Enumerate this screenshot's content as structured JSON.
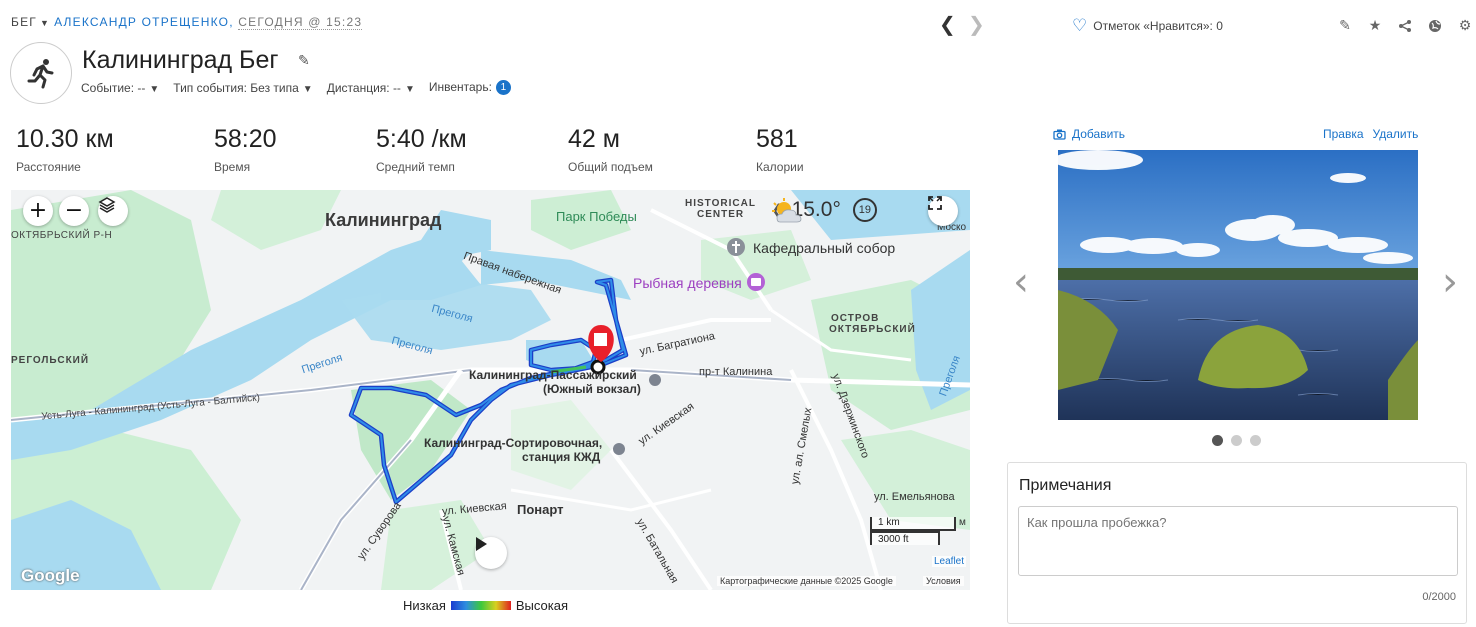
{
  "header": {
    "activity_type": "БЕГ",
    "author": "АЛЕКСАНДР ОТРЕЩЕНКО,",
    "date": "СЕГОДНЯ @ 15:23",
    "likes": "Отметок «Нравится»: 0"
  },
  "activity": {
    "title": "Калининград Бег",
    "props": {
      "event": "Событие: --",
      "event_type": "Тип события: Без типа",
      "distance": "Дистанция: --",
      "gear": "Инвентарь:",
      "gear_count": "1"
    }
  },
  "stats": [
    {
      "value": "10.30 км",
      "label": "Расстояние"
    },
    {
      "value": "58:20",
      "label": "Время"
    },
    {
      "value": "5:40 /км",
      "label": "Средний темп"
    },
    {
      "value": "42 м",
      "label": "Общий подъем"
    },
    {
      "value": "581",
      "label": "Калории"
    }
  ],
  "map": {
    "labels": {
      "city": "Калининград",
      "oktyabrsky_rn": "ОКТЯБРЬСКИЙ Р-Н",
      "park": "Парк Победы",
      "historical": "HISTORICAL",
      "center": "CENTER",
      "cathedral": "Кафедральный собор",
      "fish_village": "Рыбная деревня",
      "embankment": "Правая набережная",
      "pregolya1": "Преголя",
      "pregolya2": "Преголя",
      "pregolya3": "Преголя",
      "ostrov1": "ОСТРОВ",
      "ostrov2": "ОКТЯБРЬСКИЙ",
      "regolsky": "РЕГОЛЬСКИЙ",
      "ust_luga": "Усть-Луга - Калининград (Усть-Луга - Балтийск)",
      "bagrationa": "ул. Багратиона",
      "kalinina": "пр-т Калинина",
      "station1": "Калининград-Пассажирский",
      "station2": "(Южный вокзал)",
      "sort1": "Калининград-Сортировочная,",
      "sort2": "станция КЖД",
      "kievskaya1": "ул. Киевская",
      "kievskaya2": "ул. Киевская",
      "ponart": "Понарт",
      "suvorova": "ул. Суворова",
      "kamskaya": "ул. Камская",
      "batalnaya": "ул. Батальная",
      "smelykh": "ул. ал. Смелых",
      "dzerzhinskogo": "ул. Дзержинского",
      "emelyanova": "ул. Емельянова",
      "mosko": "Моско",
      "pregolya4": "Преголя",
      "scale_km": "1 km",
      "scale_ft": "3000 ft",
      "m": "м",
      "leaflet": "Leaflet",
      "attribution": "Картографические данные ©2025 Google",
      "terms": "Условия",
      "google": "Google"
    },
    "weather_temp": "15.0°",
    "wind": "19"
  },
  "legend": {
    "low": "Низкая",
    "high": "Высокая"
  },
  "photos": {
    "add": "Добавить",
    "edit": "Правка",
    "delete": "Удалить"
  },
  "notes": {
    "title": "Примечания",
    "placeholder": "Как прошла пробежка?",
    "counter": "0/2000"
  }
}
